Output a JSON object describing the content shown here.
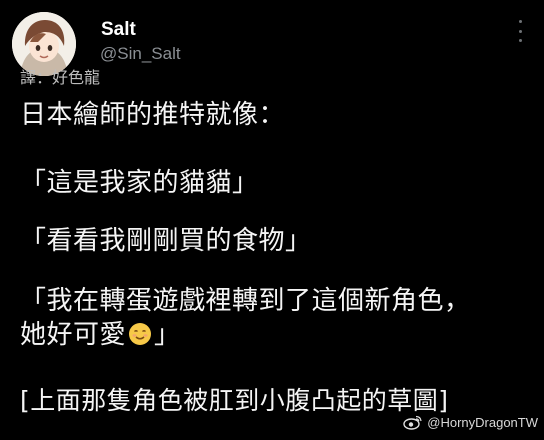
{
  "tweet": {
    "display_name": "Salt",
    "handle": "@Sin_Salt",
    "credit": "譯：好色龍",
    "lines": [
      "日本繪師的推特就像：",
      "「這是我家的貓貓」",
      "「看看我剛剛買的食物」",
      "「我在轉蛋遊戲裡轉到了這個新角色，",
      "她好可愛",
      "」",
      "[上面那隻角色被肛到小腹凸起的草圖]"
    ]
  },
  "icons": {
    "avatar": "anime-avatar",
    "more": "more-vertical-icon",
    "emoji": "smiling-face-emoji",
    "watermark": "weibo-icon"
  },
  "watermark": {
    "text": "@HornyDragonTW"
  },
  "colors": {
    "background": "#000000",
    "text": "#f5f5f5",
    "muted": "#8b8f94"
  }
}
